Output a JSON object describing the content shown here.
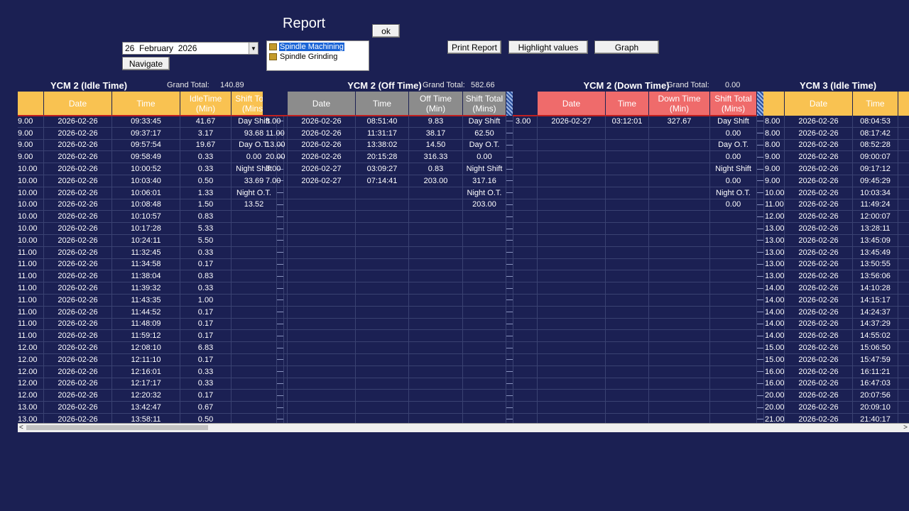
{
  "header": {
    "title": "Report",
    "date_value": "26  February  2026",
    "ok_label": "ok",
    "navigate_label": "Navigate",
    "print_label": "Print Report",
    "highlight_label": "Highlight  values",
    "graph_label": "Graph"
  },
  "listbox": {
    "items": [
      "Spindle Machining",
      "Spindle Grinding"
    ]
  },
  "colors": {
    "idle": "#f9c251",
    "off": "#8c8c8c",
    "down": "#ef6b6b",
    "background": "#1b2053"
  },
  "sections": [
    {
      "title": "YCM 2 (Idle Time)",
      "grand_total_label": "Grand Total:",
      "grand_total": "140.89",
      "headers": [
        "Date",
        "Time",
        "IdleTime\n(Min)",
        "Shift Total\n(Mins)"
      ],
      "leading": [
        "9.00",
        "9.00",
        "9.00",
        "9.00",
        "10.00",
        "10.00",
        "10.00",
        "10.00",
        "10.00",
        "10.00",
        "10.00",
        "11.00",
        "11.00",
        "11.00",
        "11.00",
        "11.00",
        "11.00",
        "11.00",
        "11.00",
        "12.00",
        "12.00",
        "12.00",
        "12.00",
        "12.00",
        "13.00",
        "13.00"
      ],
      "rows": [
        [
          "2026-02-26",
          "09:33:45",
          "41.67",
          "Day Shift"
        ],
        [
          "2026-02-26",
          "09:37:17",
          "3.17",
          "93.68"
        ],
        [
          "2026-02-26",
          "09:57:54",
          "19.67",
          "Day O.T."
        ],
        [
          "2026-02-26",
          "09:58:49",
          "0.33",
          "0.00"
        ],
        [
          "2026-02-26",
          "10:00:52",
          "0.33",
          "Night Shift"
        ],
        [
          "2026-02-26",
          "10:03:40",
          "0.50",
          "33.69"
        ],
        [
          "2026-02-26",
          "10:06:01",
          "1.33",
          "Night O.T."
        ],
        [
          "2026-02-26",
          "10:08:48",
          "1.50",
          "13.52"
        ],
        [
          "2026-02-26",
          "10:10:57",
          "0.83",
          ""
        ],
        [
          "2026-02-26",
          "10:17:28",
          "5.33",
          ""
        ],
        [
          "2026-02-26",
          "10:24:11",
          "5.50",
          ""
        ],
        [
          "2026-02-26",
          "11:32:45",
          "0.33",
          ""
        ],
        [
          "2026-02-26",
          "11:34:58",
          "0.17",
          ""
        ],
        [
          "2026-02-26",
          "11:38:04",
          "0.83",
          ""
        ],
        [
          "2026-02-26",
          "11:39:32",
          "0.33",
          ""
        ],
        [
          "2026-02-26",
          "11:43:35",
          "1.00",
          ""
        ],
        [
          "2026-02-26",
          "11:44:52",
          "0.17",
          ""
        ],
        [
          "2026-02-26",
          "11:48:09",
          "0.17",
          ""
        ],
        [
          "2026-02-26",
          "11:59:12",
          "0.17",
          ""
        ],
        [
          "2026-02-26",
          "12:08:10",
          "6.83",
          ""
        ],
        [
          "2026-02-26",
          "12:11:10",
          "0.17",
          ""
        ],
        [
          "2026-02-26",
          "12:16:01",
          "0.33",
          ""
        ],
        [
          "2026-02-26",
          "12:17:17",
          "0.33",
          ""
        ],
        [
          "2026-02-26",
          "12:20:32",
          "0.17",
          ""
        ],
        [
          "2026-02-26",
          "13:42:47",
          "0.67",
          ""
        ],
        [
          "2026-02-26",
          "13:58:11",
          "0.50",
          ""
        ]
      ]
    },
    {
      "title": "YCM 2 (Off Time)",
      "grand_total_label": "Grand Total:",
      "grand_total": "582.66",
      "headers": [
        "Date",
        "Time",
        "Off Time\n(Min)",
        "Shift Total\n(Mins)"
      ],
      "leading": [
        "8.00",
        "11.00",
        "13.00",
        "20.00",
        "3.00",
        "7.00"
      ],
      "rows": [
        [
          "2026-02-26",
          "08:51:40",
          "9.83",
          "Day Shift"
        ],
        [
          "2026-02-26",
          "11:31:17",
          "38.17",
          "62.50"
        ],
        [
          "2026-02-26",
          "13:38:02",
          "14.50",
          "Day O.T."
        ],
        [
          "2026-02-26",
          "20:15:28",
          "316.33",
          "0.00"
        ],
        [
          "2026-02-27",
          "03:09:27",
          "0.83",
          "Night Shift"
        ],
        [
          "2026-02-27",
          "07:14:41",
          "203.00",
          "317.16"
        ],
        [
          "",
          "",
          "",
          "Night O.T."
        ],
        [
          "",
          "",
          "",
          "203.00"
        ]
      ]
    },
    {
      "title": "YCM 2 (Down Time)",
      "grand_total_label": "Grand Total:",
      "grand_total": "0.00",
      "headers": [
        "Date",
        "Time",
        "Down Time\n(Min)",
        "Shift Total\n(Mins)"
      ],
      "leading": [
        "3.00"
      ],
      "rows": [
        [
          "2026-02-27",
          "03:12:01",
          "327.67",
          "Day Shift"
        ],
        [
          "",
          "",
          "",
          "0.00"
        ],
        [
          "",
          "",
          "",
          "Day O.T."
        ],
        [
          "",
          "",
          "",
          "0.00"
        ],
        [
          "",
          "",
          "",
          "Night Shift"
        ],
        [
          "",
          "",
          "",
          "0.00"
        ],
        [
          "",
          "",
          "",
          "Night O.T."
        ],
        [
          "",
          "",
          "",
          "0.00"
        ]
      ]
    },
    {
      "title": "YCM 3 (Idle Time)",
      "headers": [
        "Date",
        "Time"
      ],
      "leading": [
        "8.00",
        "8.00",
        "8.00",
        "9.00",
        "9.00",
        "9.00",
        "10.00",
        "11.00",
        "12.00",
        "13.00",
        "13.00",
        "13.00",
        "13.00",
        "13.00",
        "14.00",
        "14.00",
        "14.00",
        "14.00",
        "14.00",
        "15.00",
        "15.00",
        "16.00",
        "16.00",
        "20.00",
        "20.00",
        "21.00"
      ],
      "rows": [
        [
          "2026-02-26",
          "08:04:53"
        ],
        [
          "2026-02-26",
          "08:17:42"
        ],
        [
          "2026-02-26",
          "08:52:28"
        ],
        [
          "2026-02-26",
          "09:00:07"
        ],
        [
          "2026-02-26",
          "09:17:12"
        ],
        [
          "2026-02-26",
          "09:45:29"
        ],
        [
          "2026-02-26",
          "10:03:34"
        ],
        [
          "2026-02-26",
          "11:49:24"
        ],
        [
          "2026-02-26",
          "12:00:07"
        ],
        [
          "2026-02-26",
          "13:28:11"
        ],
        [
          "2026-02-26",
          "13:45:09"
        ],
        [
          "2026-02-26",
          "13:45:49"
        ],
        [
          "2026-02-26",
          "13:50:55"
        ],
        [
          "2026-02-26",
          "13:56:06"
        ],
        [
          "2026-02-26",
          "14:10:28"
        ],
        [
          "2026-02-26",
          "14:15:17"
        ],
        [
          "2026-02-26",
          "14:24:37"
        ],
        [
          "2026-02-26",
          "14:37:29"
        ],
        [
          "2026-02-26",
          "14:55:02"
        ],
        [
          "2026-02-26",
          "15:06:50"
        ],
        [
          "2026-02-26",
          "15:47:59"
        ],
        [
          "2026-02-26",
          "16:11:21"
        ],
        [
          "2026-02-26",
          "16:47:03"
        ],
        [
          "2026-02-26",
          "20:07:56"
        ],
        [
          "2026-02-26",
          "20:09:10"
        ],
        [
          "2026-02-26",
          "21:40:17"
        ]
      ]
    }
  ]
}
